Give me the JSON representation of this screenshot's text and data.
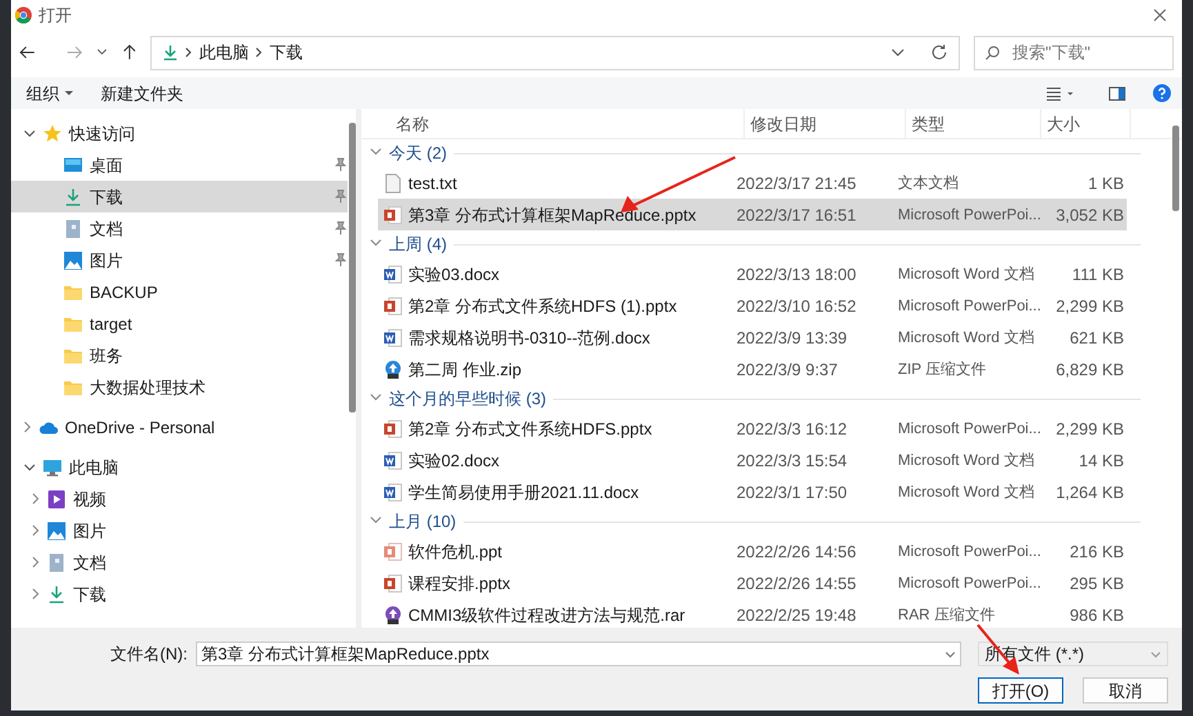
{
  "window": {
    "title": "打开"
  },
  "address": {
    "path": [
      "此电脑",
      "下载"
    ],
    "search_placeholder": "搜索\"下载\""
  },
  "toolbar": {
    "organize": "组织",
    "new_folder": "新建文件夹"
  },
  "sidebar": [
    {
      "label": "快速访问",
      "kind": "star",
      "expanded": true,
      "selected": false,
      "children": [
        {
          "label": "桌面",
          "kind": "desktop",
          "pinned": true,
          "selected": false
        },
        {
          "label": "下载",
          "kind": "download",
          "pinned": true,
          "selected": true
        },
        {
          "label": "文档",
          "kind": "docs",
          "pinned": true,
          "selected": false
        },
        {
          "label": "图片",
          "kind": "pictures",
          "pinned": true,
          "selected": false
        },
        {
          "label": "BACKUP",
          "kind": "folder",
          "pinned": false,
          "selected": false
        },
        {
          "label": "target",
          "kind": "folder",
          "pinned": false,
          "selected": false
        },
        {
          "label": "班务",
          "kind": "folder",
          "pinned": false,
          "selected": false
        },
        {
          "label": "大数据处理技术",
          "kind": "folder",
          "pinned": false,
          "selected": false
        }
      ]
    },
    {
      "label": "OneDrive - Personal",
      "kind": "cloud",
      "expanded": false,
      "selected": false
    },
    {
      "label": "此电脑",
      "kind": "pc",
      "expanded": true,
      "selected": false,
      "children": [
        {
          "label": "视频",
          "kind": "video",
          "expanded": false,
          "selected": false
        },
        {
          "label": "图片",
          "kind": "pictures",
          "expanded": false,
          "selected": false
        },
        {
          "label": "文档",
          "kind": "docs",
          "expanded": false,
          "selected": false
        },
        {
          "label": "下载",
          "kind": "download",
          "expanded": false,
          "selected": false
        }
      ]
    }
  ],
  "columns": [
    "名称",
    "修改日期",
    "类型",
    "大小"
  ],
  "groups": [
    {
      "label": "今天 (2)",
      "expanded": true,
      "files": [
        {
          "name": "test.txt",
          "kind": "txt",
          "date": "2022/3/17 21:45",
          "type": "文本文档",
          "size": "1 KB",
          "selected": false
        },
        {
          "name": "第3章 分布式计算框架MapReduce.pptx",
          "kind": "pptx",
          "date": "2022/3/17 16:51",
          "type": "Microsoft PowerPoi...",
          "size": "3,052 KB",
          "selected": true
        }
      ]
    },
    {
      "label": "上周 (4)",
      "expanded": true,
      "files": [
        {
          "name": "实验03.docx",
          "kind": "docx",
          "date": "2022/3/13 18:00",
          "type": "Microsoft Word 文档",
          "size": "111 KB",
          "selected": false
        },
        {
          "name": "第2章 分布式文件系统HDFS (1).pptx",
          "kind": "pptx",
          "date": "2022/3/10 16:52",
          "type": "Microsoft PowerPoi...",
          "size": "2,299 KB",
          "selected": false
        },
        {
          "name": "需求规格说明书-0310--范例.docx",
          "kind": "docx",
          "date": "2022/3/9 13:39",
          "type": "Microsoft Word 文档",
          "size": "621 KB",
          "selected": false
        },
        {
          "name": "第二周 作业.zip",
          "kind": "zip",
          "date": "2022/3/9 9:37",
          "type": "ZIP 压缩文件",
          "size": "6,829 KB",
          "selected": false
        }
      ]
    },
    {
      "label": "这个月的早些时候 (3)",
      "expanded": true,
      "files": [
        {
          "name": "第2章 分布式文件系统HDFS.pptx",
          "kind": "pptx",
          "date": "2022/3/3 16:12",
          "type": "Microsoft PowerPoi...",
          "size": "2,299 KB",
          "selected": false
        },
        {
          "name": "实验02.docx",
          "kind": "docx",
          "date": "2022/3/3 15:54",
          "type": "Microsoft Word 文档",
          "size": "14 KB",
          "selected": false
        },
        {
          "name": "学生简易使用手册2021.11.docx",
          "kind": "docx",
          "date": "2022/3/1 17:50",
          "type": "Microsoft Word 文档",
          "size": "1,264 KB",
          "selected": false
        }
      ]
    },
    {
      "label": "上月 (10)",
      "expanded": true,
      "files": [
        {
          "name": "软件危机.ppt",
          "kind": "ppt",
          "date": "2022/2/26 14:56",
          "type": "Microsoft PowerPoi...",
          "size": "216 KB",
          "selected": false
        },
        {
          "name": "课程安排.pptx",
          "kind": "pptx",
          "date": "2022/2/26 14:55",
          "type": "Microsoft PowerPoi...",
          "size": "295 KB",
          "selected": false
        },
        {
          "name": "CMMI3级软件过程改进方法与规范.rar",
          "kind": "rar",
          "date": "2022/2/25 19:48",
          "type": "RAR 压缩文件",
          "size": "986 KB",
          "selected": false
        }
      ]
    }
  ],
  "bottom": {
    "filename_label": "文件名(N):",
    "filename": "第3章 分布式计算框架MapReduce.pptx",
    "filter": "所有文件 (*.*)",
    "buttons": [
      "打开(O)",
      "取消"
    ]
  }
}
